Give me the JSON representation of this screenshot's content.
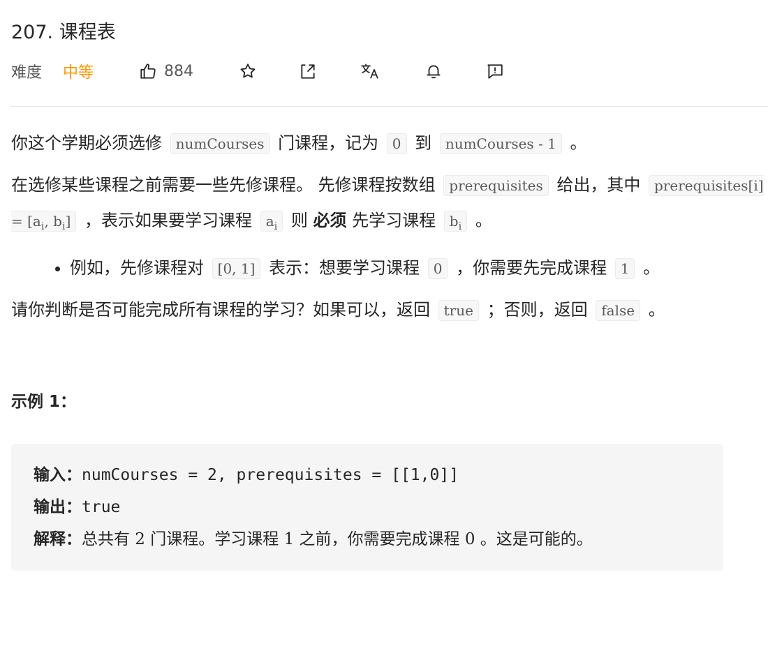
{
  "problem": {
    "title": "207. 课程表",
    "difficulty_label": "难度",
    "difficulty": "中等",
    "likes": "884"
  },
  "description": {
    "p1": [
      "你这个学期必须选修",
      "numCourses",
      "门课程，记为",
      "0",
      "到",
      "numCourses - 1",
      "。"
    ],
    "p2": {
      "t1": "在选修某些课程之前需要一些先修课程。 先修课程按数组",
      "c1": "prerequisites",
      "t2": "给出，其中",
      "c2a": "prerequisites[i] = [a",
      "c2sub1": "i",
      "c2b": ", b",
      "c2sub2": "i",
      "c2c": "]",
      "t3": "，表示如果要学习课程",
      "c3": "a",
      "c3sub": "i",
      "t4": "则",
      "bold": "必须",
      "t5": "先学习课程",
      "c4": "b",
      "c4sub": "i",
      "t6": "。"
    },
    "bullet": [
      "例如，先修课程对",
      "[0, 1]",
      "表示：想要学习课程",
      "0",
      "，你需要先完成课程",
      "1",
      "。"
    ],
    "p3": [
      "请你判断是否可能完成所有课程的学习？如果可以，返回",
      "true",
      "；否则，返回",
      "false",
      "。"
    ]
  },
  "example": {
    "title": "示例 1：",
    "input_label": "输入：",
    "input_value": "numCourses = 2, prerequisites = [[1,0]]",
    "output_label": "输出：",
    "output_value": "true",
    "explain_label": "解释：",
    "explain_value": "总共有 2 门课程。学习课程 1 之前，你需要完成课程 0 。这是可能的。"
  },
  "colors": {
    "accent_medium": "#ff9800",
    "text": "#262626",
    "muted": "#595959"
  },
  "icons": [
    "thumbs-up-icon",
    "star-icon",
    "share-icon",
    "translate-icon",
    "bell-icon",
    "feedback-icon"
  ]
}
